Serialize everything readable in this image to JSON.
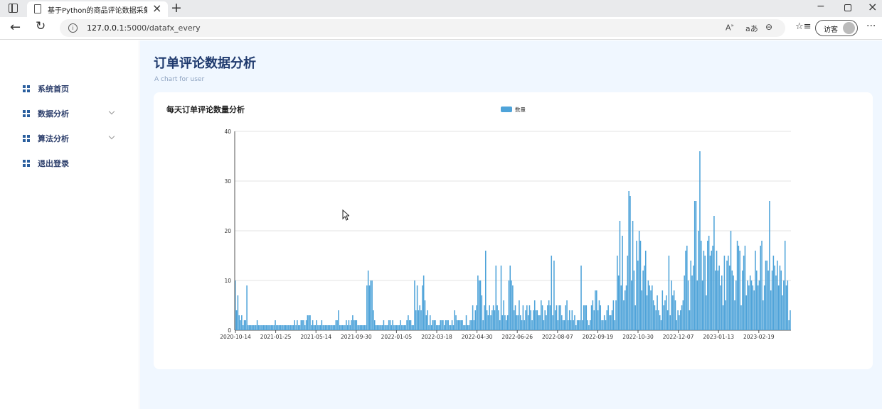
{
  "browser": {
    "tab_title": "基于Python的商品评论数据采集",
    "tab_close": "×",
    "new_tab": "+",
    "url_host": "127.0.0.1",
    "url_rest": ":5000/datafx_every",
    "read_aloud": "A͡",
    "translate": "aあ",
    "guest_label": "访客",
    "more": "···",
    "minimize": "−",
    "close": "×"
  },
  "sidebar": {
    "items": [
      {
        "label": "系统首页",
        "has_chevron": false
      },
      {
        "label": "数据分析",
        "has_chevron": true
      },
      {
        "label": "算法分析",
        "has_chevron": true
      },
      {
        "label": "退出登录",
        "has_chevron": false
      }
    ]
  },
  "main": {
    "title": "订单评论数据分析",
    "subtitle": "A chart for user"
  },
  "colors": {
    "bar": "#4ea3d9",
    "accent": "#1f3a6e",
    "grid": "#e3e3e3"
  },
  "chart_data": {
    "type": "bar",
    "title": "每天订单评论数量分析",
    "legend": [
      "数量"
    ],
    "legend_placement": "top-center",
    "ylim": [
      0,
      40
    ],
    "yticks": [
      0,
      10,
      20,
      30,
      40
    ],
    "grid": true,
    "xticks": [
      "2020-10-14",
      "2021-01-25",
      "2021-05-14",
      "2021-09-30",
      "2022-01-05",
      "2022-03-18",
      "2022-04-30",
      "2022-06-26",
      "2022-08-07",
      "2022-09-19",
      "2022-10-30",
      "2022-12-07",
      "2023-01-13",
      "2023-02-19"
    ],
    "series": [
      {
        "name": "数量",
        "values": [
          10,
          4,
          7,
          3,
          2,
          3,
          1,
          2,
          2,
          9,
          1,
          1,
          1,
          1,
          1,
          1,
          1,
          2,
          1,
          1,
          1,
          1,
          1,
          1,
          1,
          1,
          1,
          1,
          1,
          1,
          1,
          2,
          1,
          1,
          1,
          1,
          1,
          1,
          1,
          1,
          1,
          1,
          1,
          1,
          1,
          1,
          2,
          1,
          2,
          1,
          1,
          2,
          2,
          2,
          1,
          2,
          3,
          3,
          3,
          1,
          2,
          1,
          1,
          2,
          1,
          1,
          1,
          2,
          1,
          1,
          1,
          1,
          1,
          1,
          1,
          1,
          1,
          1,
          2,
          2,
          4,
          1,
          1,
          1,
          1,
          1,
          2,
          1,
          2,
          1,
          2,
          3,
          2,
          2,
          2,
          1,
          1,
          1,
          1,
          1,
          1,
          1,
          9,
          12,
          9,
          10,
          10,
          4,
          2,
          1,
          1,
          1,
          1,
          1,
          1,
          2,
          1,
          1,
          1,
          2,
          2,
          1,
          2,
          1,
          1,
          1,
          1,
          1,
          2,
          1,
          1,
          1,
          1,
          2,
          3,
          2,
          2,
          1,
          1,
          10,
          4,
          9,
          4,
          5,
          4,
          9,
          11,
          6,
          3,
          4,
          1,
          3,
          1,
          2,
          2,
          2,
          1,
          1,
          1,
          2,
          2,
          2,
          1,
          2,
          2,
          2,
          1,
          1,
          2,
          1,
          4,
          3,
          2,
          2,
          2,
          2,
          2,
          1,
          1,
          3,
          1,
          1,
          2,
          2,
          5,
          2,
          4,
          5,
          11,
          10,
          10,
          7,
          2,
          5,
          16,
          4,
          3,
          5,
          3,
          4,
          5,
          4,
          13,
          5,
          4,
          2,
          13,
          3,
          6,
          3,
          2,
          3,
          10,
          13,
          10,
          9,
          4,
          5,
          3,
          3,
          6,
          3,
          2,
          5,
          2,
          4,
          5,
          3,
          5,
          4,
          2,
          4,
          6,
          4,
          4,
          3,
          3,
          6,
          5,
          2,
          4,
          3,
          5,
          6,
          5,
          15,
          3,
          14,
          4,
          5,
          2,
          5,
          5,
          3,
          2,
          2,
          5,
          6,
          2,
          4,
          2,
          4,
          2,
          3,
          1,
          2,
          2,
          2,
          13,
          2,
          5,
          5,
          5,
          2,
          1,
          2,
          5,
          6,
          4,
          8,
          8,
          4,
          6,
          5,
          2,
          2,
          3,
          2,
          4,
          5,
          3,
          3,
          4,
          6,
          2,
          6,
          15,
          11,
          22,
          9,
          19,
          6,
          8,
          9,
          15,
          28,
          27,
          10,
          22,
          12,
          5,
          18,
          14,
          20,
          18,
          8,
          12,
          13,
          16,
          7,
          10,
          9,
          8,
          9,
          6,
          5,
          4,
          7,
          4,
          3,
          2,
          8,
          5,
          6,
          7,
          4,
          15,
          3,
          10,
          7,
          8,
          6,
          2,
          4,
          3,
          4,
          5,
          6,
          11,
          16,
          17,
          10,
          4,
          14,
          11,
          13,
          26,
          26,
          10,
          20,
          36,
          18,
          10,
          16,
          15,
          7,
          18,
          19,
          15,
          16,
          17,
          23,
          12,
          16,
          12,
          13,
          9,
          11,
          5,
          15,
          6,
          14,
          15,
          13,
          20,
          12,
          11,
          6,
          10,
          18,
          17,
          16,
          5,
          12,
          15,
          17,
          7,
          10,
          9,
          11,
          10,
          9,
          8,
          16,
          12,
          9,
          10,
          17,
          18,
          6,
          9,
          14,
          14,
          12,
          26,
          8,
          12,
          15,
          13,
          11,
          14,
          9,
          13,
          12,
          7,
          10,
          18,
          9,
          10,
          2,
          4
        ]
      }
    ]
  }
}
